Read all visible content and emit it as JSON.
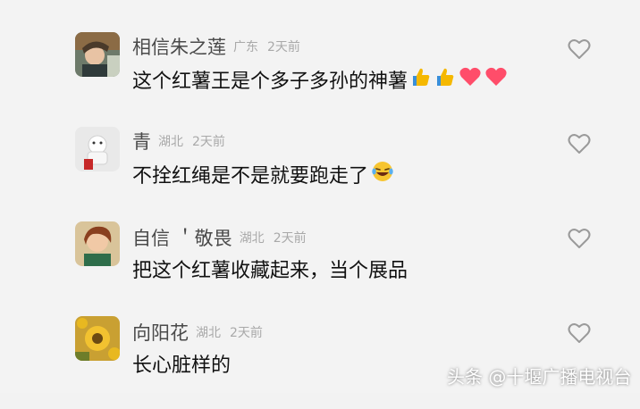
{
  "comments": [
    {
      "username": "相信朱之莲",
      "region": "广东",
      "time": "2天前",
      "text": "这个红薯王是个多子多孙的神薯",
      "emojis": [
        "thumbs-up-icon",
        "thumbs-up-icon",
        "red-heart-icon",
        "red-heart-icon"
      ]
    },
    {
      "username": "青",
      "region": "湖北",
      "time": "2天前",
      "text": "不拴红绳是不是就要跑走了",
      "emojis": [
        "laughing-tears-icon"
      ]
    },
    {
      "username": "自信 ＇敬畏",
      "region": "湖北",
      "time": "2天前",
      "text": "把这个红薯收藏起来，当个展品",
      "emojis": []
    },
    {
      "username": "向阳花",
      "region": "湖北",
      "time": "2天前",
      "text": "长心脏样的",
      "emojis": []
    }
  ],
  "watermark": "头条 @十堰广播电视台",
  "colors": {
    "heart": "#ff4d6a",
    "thumb": "#f5b800",
    "username": "#4a4a4a",
    "meta": "#a9a9a9"
  }
}
